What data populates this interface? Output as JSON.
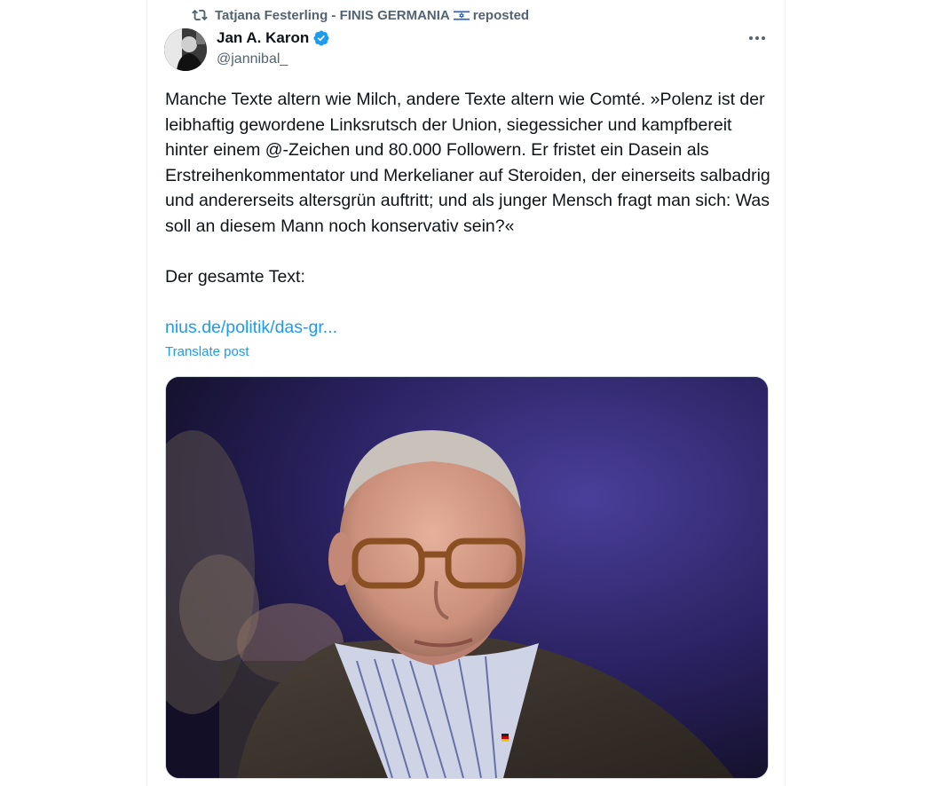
{
  "repost": {
    "name": "Tatjana Festerling - FINIS GERMANIA",
    "suffix": "reposted",
    "icon": "repost-icon",
    "flag_icon": "israel-flag-icon"
  },
  "author": {
    "name": "Jan A. Karon",
    "handle": "@jannibal_",
    "verified_icon": "verified-badge-icon",
    "verified_color": "#1d9bf0"
  },
  "tweet": {
    "text": "Manche Texte altern wie Milch, andere Texte altern wie Comté. »Polenz ist der leibhaftig gewordene Linksrutsch der Union, siegessicher und kampfbereit hinter einem @-Zeichen und 80.000 Followern. Er fristet ein Dasein als Erstreihenkommentator und Merkelianer auf Steroiden, der einerseits salbadrig und andererseits altersgrün auftritt; und als junger Mensch fragt man sich: Was soll an diesem Mann noch konservativ sein?«\n\nDer gesamte Text:",
    "link": "nius.de/politik/das-gr...",
    "translate": "Translate post"
  },
  "colors": {
    "link": "#1d9bf0",
    "secondary_text": "#536471",
    "primary_text": "#0f1419"
  }
}
